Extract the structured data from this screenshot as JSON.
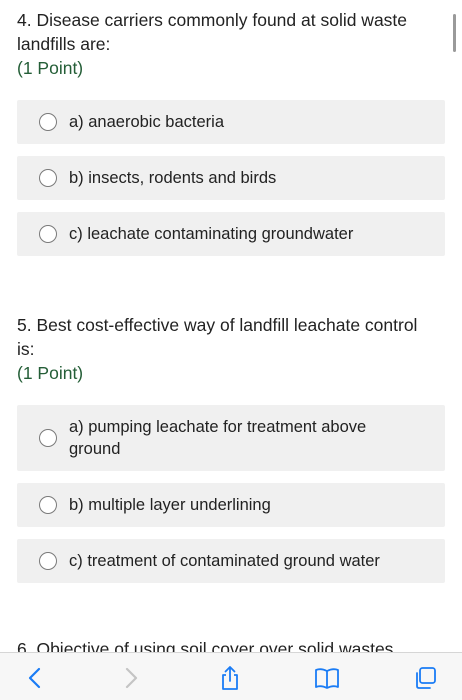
{
  "questions": [
    {
      "number_text": "4. Disease carriers commonly found at solid waste landfills are:",
      "points": "(1 Point)",
      "options": [
        {
          "label": "a) anaerobic bacteria"
        },
        {
          "label": "b) insects, rodents and birds"
        },
        {
          "label": "c) leachate contaminating groundwater"
        }
      ]
    },
    {
      "number_text": "5. Best cost-effective way of landfill leachate control is:",
      "points": "(1 Point)",
      "options": [
        {
          "label": "a) pumping leachate for treatment above ground"
        },
        {
          "label": "b) multiple layer underlining"
        },
        {
          "label": "c) treatment of contaminated ground water"
        }
      ]
    }
  ],
  "next_question_partial": "6. Objective of using soil cover over solid wastes",
  "toolbar": {
    "icons": [
      "back-icon",
      "forward-icon",
      "share-icon",
      "bookmarks-icon",
      "tabs-icon"
    ],
    "accent": "#1a7cf5",
    "disabled": "#c4c4c4"
  }
}
